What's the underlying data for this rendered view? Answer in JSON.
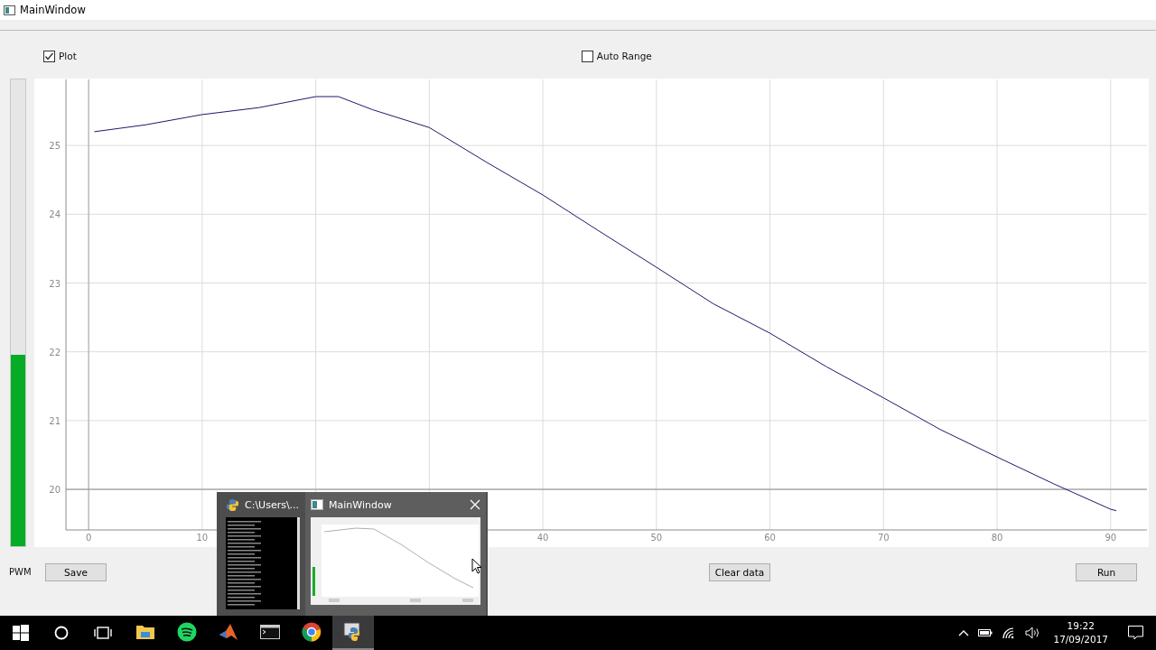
{
  "window": {
    "title": "MainWindow"
  },
  "checkboxes": [
    {
      "label": "Plot",
      "checked": true
    },
    {
      "label": "Auto Range",
      "checked": false
    }
  ],
  "pwm_meter": {
    "level": 0.41
  },
  "chart": {
    "chart_data": {
      "type": "line",
      "x": [
        0.5,
        5,
        10,
        15,
        20,
        22,
        25,
        30,
        35,
        40,
        45,
        50,
        55,
        60,
        65,
        70,
        75,
        80,
        85,
        90,
        90.5
      ],
      "xlim": [
        -2,
        93.2
      ],
      "ylim": [
        19.41,
        25.96
      ],
      "xticks": [
        0,
        10,
        40,
        50,
        60,
        70,
        80,
        90
      ],
      "yticks": [
        20,
        21,
        22,
        23,
        24,
        25
      ],
      "grid": true,
      "ref_lines": [
        {
          "axis": "x",
          "value": 0
        },
        {
          "axis": "y",
          "value": 20
        }
      ],
      "series": [
        {
          "color": "#1a1a6e",
          "values": [
            25.2,
            25.3,
            25.45,
            25.55,
            25.71,
            25.71,
            25.52,
            25.26,
            24.76,
            24.28,
            23.75,
            23.23,
            22.7,
            22.27,
            21.78,
            21.33,
            20.87,
            20.47,
            20.08,
            19.71,
            19.69
          ]
        }
      ]
    }
  },
  "bottom": {
    "label": "PWM",
    "buttons": [
      "Save",
      "Clear data",
      "Run"
    ]
  },
  "taskbar_preview": {
    "items": [
      {
        "title": "C:\\Users\\...",
        "kind": "console",
        "selected": false
      },
      {
        "title": "MainWindow",
        "kind": "window",
        "selected": true
      }
    ]
  },
  "taskbar": {
    "apps": [
      {
        "kind": "folder",
        "selected": false
      },
      {
        "kind": "music",
        "selected": false
      },
      {
        "kind": "math",
        "selected": false
      },
      {
        "kind": "terminal",
        "selected": false
      },
      {
        "kind": "browser",
        "selected": false
      },
      {
        "kind": "python",
        "selected": true
      }
    ],
    "time": "19:22",
    "date": "17/09/2017"
  }
}
